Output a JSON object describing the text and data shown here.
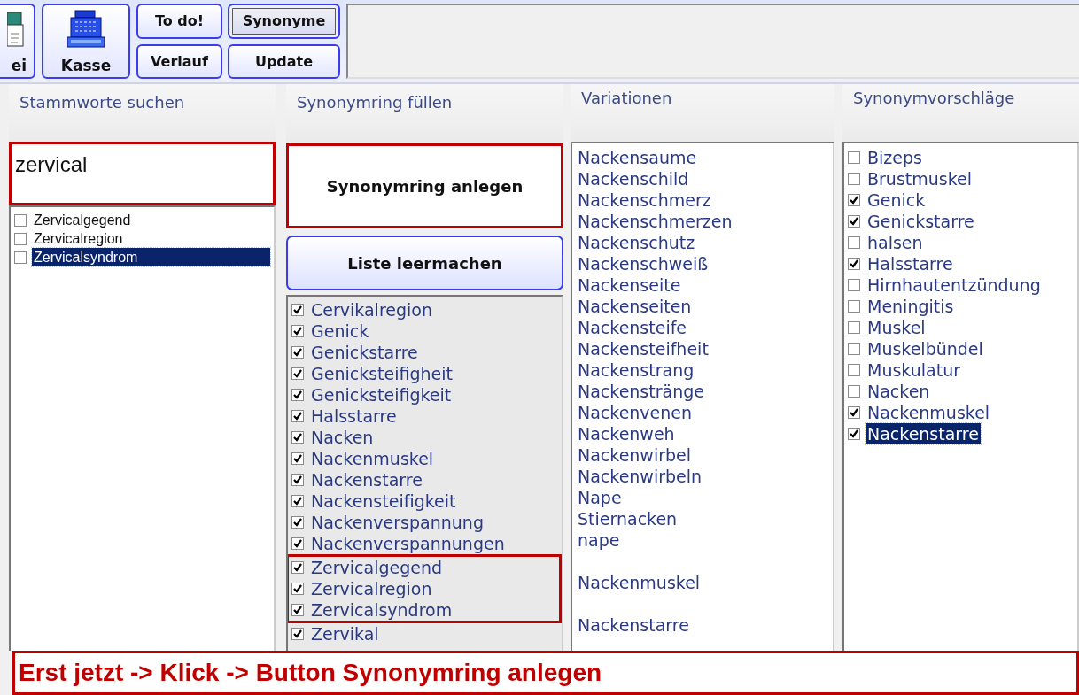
{
  "toolbar": {
    "big_buttons": [
      {
        "kind": "file",
        "label": "ei"
      },
      {
        "kind": "register",
        "label": "Kasse"
      }
    ],
    "small_buttons": [
      {
        "label": "To do!",
        "focused": false
      },
      {
        "label": "Synonyme",
        "focused": true
      },
      {
        "label": "Verlauf",
        "focused": false
      },
      {
        "label": "Update",
        "focused": false
      }
    ]
  },
  "stems": {
    "title": "Stammworte suchen",
    "search": {
      "value": "zervical",
      "highlighted": true
    },
    "items": [
      {
        "label": "Zervicalgegend",
        "checked": false,
        "selected": false
      },
      {
        "label": "Zervicalregion",
        "checked": false,
        "selected": false
      },
      {
        "label": "Zervicalsyndrom",
        "checked": false,
        "selected": true
      }
    ]
  },
  "ring": {
    "title": "Synonymring füllen",
    "create_button": {
      "label": "Synonymring anlegen",
      "highlighted": true
    },
    "clear_button": {
      "label": "Liste leermachen"
    },
    "items": [
      {
        "label": "Cervikalregion",
        "checked": true,
        "highlighted": false
      },
      {
        "label": "Genick",
        "checked": true,
        "highlighted": false
      },
      {
        "label": "Genickstarre",
        "checked": true,
        "highlighted": false
      },
      {
        "label": "Genicksteifigheit",
        "checked": true,
        "highlighted": false
      },
      {
        "label": "Genicksteifigkeit",
        "checked": true,
        "highlighted": false
      },
      {
        "label": "Halsstarre",
        "checked": true,
        "highlighted": false
      },
      {
        "label": "Nacken",
        "checked": true,
        "highlighted": false
      },
      {
        "label": "Nackenmuskel",
        "checked": true,
        "highlighted": false
      },
      {
        "label": "Nackenstarre",
        "checked": true,
        "highlighted": false
      },
      {
        "label": "Nackensteifigkeit",
        "checked": true,
        "highlighted": false
      },
      {
        "label": "Nackenverspannung",
        "checked": true,
        "highlighted": false
      },
      {
        "label": "Nackenverspannungen",
        "checked": true,
        "highlighted": false
      },
      {
        "label": "Zervicalgegend",
        "checked": true,
        "highlighted": true
      },
      {
        "label": "Zervicalregion",
        "checked": true,
        "highlighted": true
      },
      {
        "label": "Zervicalsyndrom",
        "checked": true,
        "highlighted": true
      },
      {
        "label": "Zervikal",
        "checked": true,
        "highlighted": false
      }
    ]
  },
  "variations": {
    "title": "Variationen",
    "items": [
      {
        "label": "Nackensaume",
        "gap_before": false
      },
      {
        "label": "Nackenschild",
        "gap_before": false
      },
      {
        "label": "Nackenschmerz",
        "gap_before": false
      },
      {
        "label": "Nackenschmerzen",
        "gap_before": false
      },
      {
        "label": "Nackenschutz",
        "gap_before": false
      },
      {
        "label": "Nackenschweiß",
        "gap_before": false
      },
      {
        "label": "Nackenseite",
        "gap_before": false
      },
      {
        "label": "Nackenseiten",
        "gap_before": false
      },
      {
        "label": "Nackensteife",
        "gap_before": false
      },
      {
        "label": "Nackensteifheit",
        "gap_before": false
      },
      {
        "label": "Nackenstrang",
        "gap_before": false
      },
      {
        "label": "Nackenstränge",
        "gap_before": false
      },
      {
        "label": "Nackenvenen",
        "gap_before": false
      },
      {
        "label": "Nackenweh",
        "gap_before": false
      },
      {
        "label": "Nackenwirbel",
        "gap_before": false
      },
      {
        "label": "Nackenwirbeln",
        "gap_before": false
      },
      {
        "label": "Nape",
        "gap_before": false
      },
      {
        "label": "Stiernacken",
        "gap_before": false
      },
      {
        "label": "nape",
        "gap_before": false
      },
      {
        "label": "Nackenmuskel",
        "gap_before": true
      },
      {
        "label": "Nackenstarre",
        "gap_before": true
      }
    ]
  },
  "suggestions": {
    "title": "Synonymvorschläge",
    "items": [
      {
        "label": "Bizeps",
        "checked": false,
        "selected": false
      },
      {
        "label": "Brustmuskel",
        "checked": false,
        "selected": false
      },
      {
        "label": "Genick",
        "checked": true,
        "selected": false
      },
      {
        "label": "Genickstarre",
        "checked": true,
        "selected": false
      },
      {
        "label": "halsen",
        "checked": false,
        "selected": false
      },
      {
        "label": "Halsstarre",
        "checked": true,
        "selected": false
      },
      {
        "label": "Hirnhautentzündung",
        "checked": false,
        "selected": false
      },
      {
        "label": "Meningitis",
        "checked": false,
        "selected": false
      },
      {
        "label": "Muskel",
        "checked": false,
        "selected": false
      },
      {
        "label": "Muskelbündel",
        "checked": false,
        "selected": false
      },
      {
        "label": "Muskulatur",
        "checked": false,
        "selected": false
      },
      {
        "label": "Nacken",
        "checked": false,
        "selected": false
      },
      {
        "label": "Nackenmuskel",
        "checked": true,
        "selected": false
      },
      {
        "label": "Nackenstarre",
        "checked": true,
        "selected": true
      }
    ]
  },
  "banner": {
    "text": "Erst jetzt -> Klick -> Button Synonymring anlegen"
  }
}
